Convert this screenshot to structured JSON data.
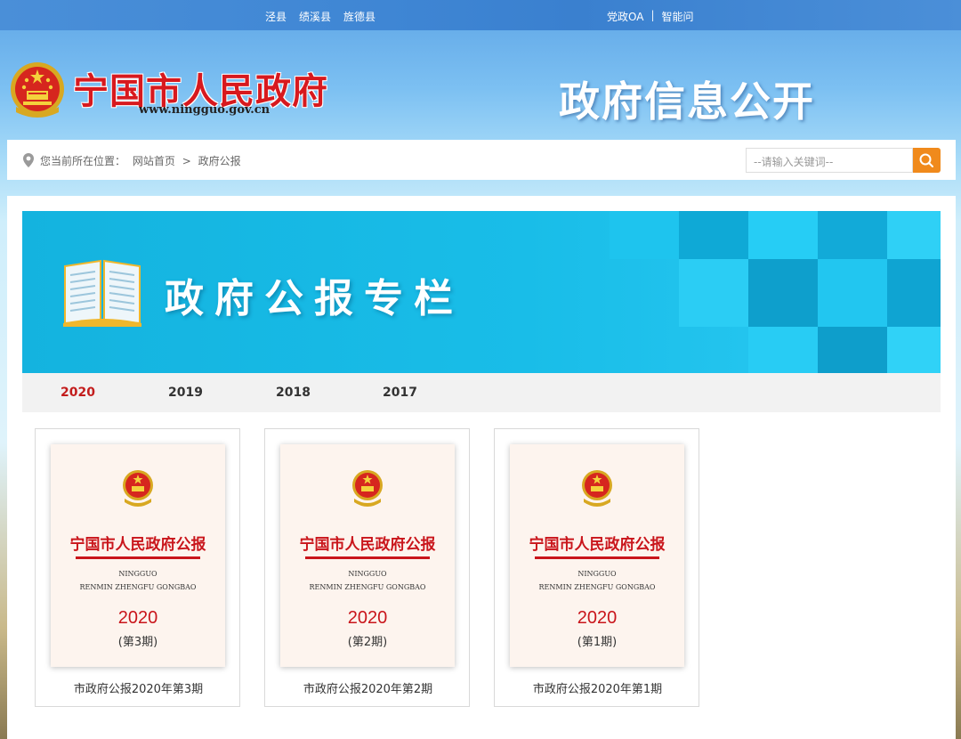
{
  "topbar": {
    "counties": [
      "泾县",
      "绩溪县",
      "旌德县"
    ],
    "oa_link": "党政OA",
    "separator": "|",
    "smart_link": "智能问",
    "smart_link_tail": "问"
  },
  "header": {
    "site_title": "宁国市人民政府",
    "site_url": "www.ningguo.gov.cn",
    "section_title": "政府信息公开"
  },
  "location": {
    "label": "您当前所在位置：",
    "home": "网站首页",
    "arrow": ">",
    "current": "政府公报"
  },
  "search": {
    "placeholder": "--请输入关键词--",
    "icon": "search-icon"
  },
  "banner": {
    "title": "政府公报专栏",
    "colors": {
      "primary": "#14b3df",
      "tile_light": "#2ccaf3",
      "tile_dark": "#0fa2cf"
    }
  },
  "tabs": {
    "items": [
      {
        "label": "2020",
        "active": true
      },
      {
        "label": "2019",
        "active": false
      },
      {
        "label": "2018",
        "active": false
      },
      {
        "label": "2017",
        "active": false
      }
    ]
  },
  "cards": [
    {
      "cover_title": "宁国市人民政府公报",
      "en1": "NINGGUO",
      "en2": "RENMIN ZHENGFU GONGBAO",
      "year": "2020",
      "issue": "(第3期)",
      "caption": "市政府公报2020年第3期"
    },
    {
      "cover_title": "宁国市人民政府公报",
      "en1": "NINGGUO",
      "en2": "RENMIN ZHENGFU GONGBAO",
      "year": "2020",
      "issue": "(第2期)",
      "caption": "市政府公报2020年第2期"
    },
    {
      "cover_title": "宁国市人民政府公报",
      "en1": "NINGGUO",
      "en2": "RENMIN ZHENGFU GONGBAO",
      "year": "2020",
      "issue": "(第1期)",
      "caption": "市政府公报2020年第1期"
    }
  ],
  "colors": {
    "accent_red": "#c31d1d",
    "search_orange": "#f08a1c"
  }
}
